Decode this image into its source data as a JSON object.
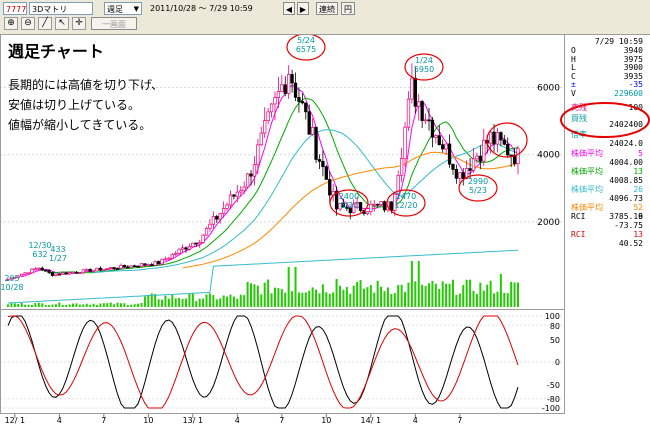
{
  "toolbar": {
    "code": "7777",
    "name": "3Dマトリ",
    "period": "週足",
    "date_range": "2011/10/28 ～ 7/29 10:59",
    "link_label": "連続",
    "yen_label": "円",
    "overlay_label": "一画面",
    "icons": [
      "zoom-in-icon",
      "zoom-out-icon",
      "line-tool-icon",
      "pointer-icon",
      "crosshair-icon"
    ]
  },
  "annotation": {
    "title": "週足チャート",
    "lines": [
      "長期的には高値を切り下げ、",
      "安値は切り上げている。",
      "値幅が縮小してきている。"
    ]
  },
  "sidebar": {
    "datetime": "7/29 10:59",
    "ohlc": [
      {
        "label": "O",
        "value": "3940"
      },
      {
        "label": "H",
        "value": "3975"
      },
      {
        "label": "L",
        "value": "3900"
      },
      {
        "label": "C",
        "value": "3935"
      },
      {
        "label": "±",
        "value": "-35"
      },
      {
        "label": "V",
        "value": "229600"
      }
    ],
    "margin_sell_label": "売残",
    "margin_sell_value": "100",
    "margin_buy_label": "買残",
    "margin_buy_value": "2402400",
    "ratio_label": "倍率",
    "ratio_value": "24024.0",
    "ma": [
      {
        "label": "株価平均",
        "period": "5",
        "value": "4004.00"
      },
      {
        "label": "株価平均",
        "period": "13",
        "value": "4008.85"
      },
      {
        "label": "株価平均",
        "period": "26",
        "value": "4096.73"
      },
      {
        "label": "株価平均",
        "period": "52",
        "value": "3785.16"
      }
    ],
    "rci": [
      {
        "label": "RCI",
        "period": "9",
        "value": "-73.75"
      },
      {
        "label": "RCI",
        "period": "13",
        "value": "40.52"
      }
    ]
  },
  "axes": {
    "price_ticks": [
      "6000",
      "4000",
      "2000"
    ],
    "rci_ticks": [
      "100",
      "80",
      "50",
      "0",
      "-50",
      "-80",
      "-100"
    ],
    "x_labels": [
      "12/ 1",
      "4",
      "7",
      "10",
      "13/ 1",
      "4",
      "7",
      "10",
      "14/ 1",
      "4",
      "7"
    ]
  },
  "price_labels": [
    {
      "text": "295\n10/28",
      "circled": false
    },
    {
      "text": "433\n1/27",
      "circled": false
    },
    {
      "text": "12/30\n632",
      "circled": false
    },
    {
      "text": "5/24\n6575",
      "circled": true
    },
    {
      "text": "2400\n8/30",
      "circled": true
    },
    {
      "text": "2470\n12/20",
      "circled": true
    },
    {
      "text": "1/24\n5950",
      "circled": true
    },
    {
      "text": "2990\n5/23",
      "circled": true
    }
  ],
  "colors": {
    "up": "#e8007a",
    "down": "#000000",
    "ma5": "#ff00ff",
    "ma13": "#00aa00",
    "ma26": "#33bbcc",
    "ma52": "#ff8800",
    "volume": "#22cc00",
    "volume_line": "#33bbcc",
    "rci9": "#000000",
    "rci13": "#dd0000",
    "highlight": "#e60000",
    "label_cyan": "#009aa0"
  }
}
